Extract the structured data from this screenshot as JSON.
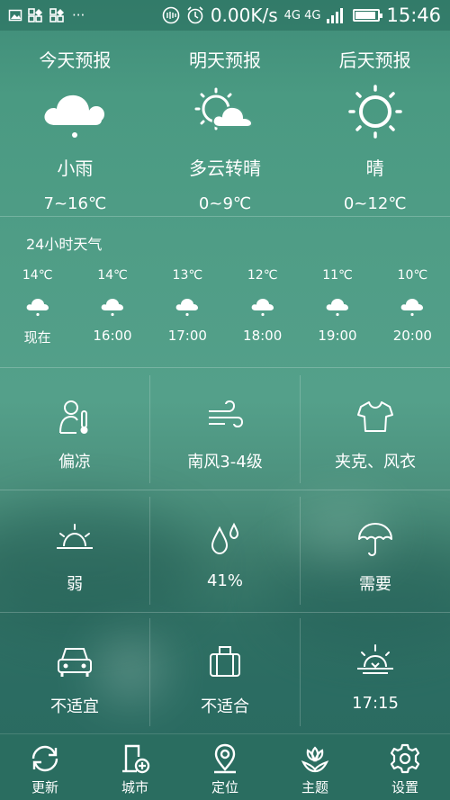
{
  "status_bar": {
    "speed": "0.00K/s",
    "network_label": "4G 4G",
    "time": "15:46",
    "battery_percent": 90,
    "left_icons": [
      "image-icon",
      "grid-icon",
      "grid-icon",
      "more-icon"
    ],
    "right_icons": [
      "nfc-icon",
      "alarm-icon",
      "signal-icon",
      "battery-icon"
    ],
    "more_label": "···"
  },
  "forecast": [
    {
      "title": "今天预报",
      "condition": "小雨",
      "temp": "7~16℃",
      "icon": "light-rain-icon"
    },
    {
      "title": "明天预报",
      "condition": "多云转晴",
      "temp": "0~9℃",
      "icon": "partly-cloudy-icon"
    },
    {
      "title": "后天预报",
      "condition": "晴",
      "temp": "0~12℃",
      "icon": "sunny-icon"
    }
  ],
  "hourly": {
    "title": "24小时天气",
    "items": [
      {
        "temp": "14℃",
        "time": "现在",
        "icon": "cloud-rain-icon"
      },
      {
        "temp": "14℃",
        "time": "16:00",
        "icon": "cloud-rain-icon"
      },
      {
        "temp": "13℃",
        "time": "17:00",
        "icon": "cloud-rain-icon"
      },
      {
        "temp": "12℃",
        "time": "18:00",
        "icon": "cloud-rain-icon"
      },
      {
        "temp": "11℃",
        "time": "19:00",
        "icon": "cloud-rain-icon"
      },
      {
        "temp": "10℃",
        "time": "20:00",
        "icon": "cloud-rain-icon"
      }
    ]
  },
  "indexes": [
    {
      "label": "偏凉",
      "icon": "body-temperature-icon"
    },
    {
      "label": "南风3-4级",
      "icon": "wind-icon"
    },
    {
      "label": "夹克、风衣",
      "icon": "clothing-icon"
    },
    {
      "label": "弱",
      "icon": "uv-sunrise-icon"
    },
    {
      "label": "41%",
      "icon": "humidity-drops-icon"
    },
    {
      "label": "需要",
      "icon": "umbrella-icon"
    },
    {
      "label": "不适宜",
      "icon": "car-wash-icon"
    },
    {
      "label": "不适合",
      "icon": "luggage-icon"
    },
    {
      "label": "17:15",
      "icon": "sunset-icon"
    }
  ],
  "nav": [
    {
      "label": "更新",
      "icon": "refresh-icon"
    },
    {
      "label": "城市",
      "icon": "add-city-icon"
    },
    {
      "label": "定位",
      "icon": "location-icon"
    },
    {
      "label": "主题",
      "icon": "theme-icon"
    },
    {
      "label": "设置",
      "icon": "settings-icon"
    }
  ]
}
